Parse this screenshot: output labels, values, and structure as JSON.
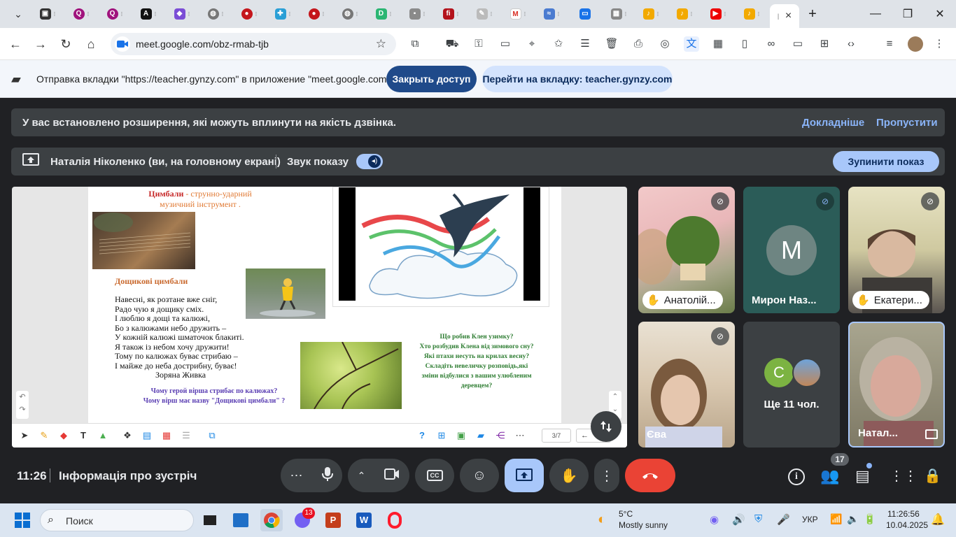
{
  "browser": {
    "tab_close": "×",
    "new_tab": "+",
    "url": "meet.google.com/obz-rmab-tjb",
    "window": {
      "minimize": "—",
      "maximize": "❐",
      "close": "✕"
    }
  },
  "sharebar": {
    "message": "Отправка вкладки \"https://teacher.gynzy.com\" в приложение \"meet.google.com\"...",
    "stop_button": "Закрыть доступ",
    "switch_button": "Перейти на вкладку: teacher.gynzy.com"
  },
  "meet": {
    "extension_banner": "У вас встановлено розширення, які можуть вплинути на якість дзвінка.",
    "learn_more": "Докладніше",
    "skip": "Пропустити",
    "presenter": "Наталія Ніколенко (ви, на головному екрані)",
    "share_sound": "Звук показу",
    "stop_presenting": "Зупинити показ",
    "time": "11:26",
    "meeting_info": "Інформація про зустріч",
    "people_count": "17"
  },
  "slide": {
    "title_red": "Цимбали",
    "title_rest": " - струнно-ударний",
    "title_line2": "музичний інструмент .",
    "poem_title": "Дощикові цимбали",
    "poem": [
      "Навесні, як розтане вже сніг,",
      "Радо чую я дощику сміх.",
      "І люблю я дощі та калюжі,",
      "Бо з калюжами небо дружить –",
      "У кожній калюжі шматочок блакиті.",
      "Я також із небом хочу дружити!",
      "Тому по калюжах буває стрибаю –",
      "І майже до неба дострибну, буває!"
    ],
    "author": "Зоряна Живка",
    "question1": "Чому герой вірша стрибає по калюжах?",
    "question2": "Чому вірш має назву \"Дощикові цимбали\" ?",
    "questions_right": [
      "Що робив Клен узимку?",
      "Хто розбудив Клена від зимового сну?",
      "Які птахи несуть на крилах весну?",
      "Складіть невеличку розповідь,які",
      "зміни відбулися з вашим улюбленим",
      "деревцем?"
    ],
    "page": "3/7"
  },
  "participants": [
    {
      "name": "Анатолій...",
      "type": "video",
      "hand": true,
      "muted": true
    },
    {
      "name": "Мирон Наз...",
      "type": "avatar",
      "initial": "M",
      "muted": true
    },
    {
      "name": "Екатери...",
      "type": "video",
      "hand": true,
      "muted": true
    },
    {
      "name": "Єва",
      "type": "video",
      "muted": true
    },
    {
      "name": "Ще 11 чол.",
      "type": "more",
      "initial": "C"
    },
    {
      "name": "Натал...",
      "type": "video"
    }
  ],
  "taskbar": {
    "search": "Поиск",
    "weather_temp": "5°C",
    "weather_desc": "Mostly sunny",
    "lang": "УКР",
    "clock_time": "11:26:56",
    "clock_date": "10.04.2025",
    "viber_badge": "13"
  },
  "colors": {
    "meet_bg": "#202124",
    "panel": "#3c4043",
    "accent_blue": "#8ab4f8",
    "end_call_red": "#ea4335",
    "share_blue": "#1a73e8"
  }
}
